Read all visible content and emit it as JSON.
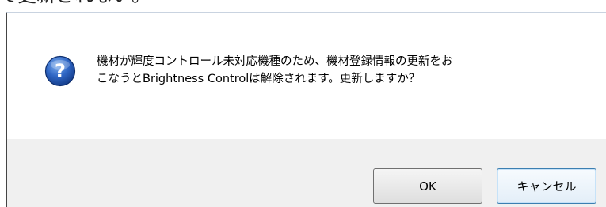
{
  "background_text": "て更新されない。",
  "dialog": {
    "icon": "question-icon",
    "message_line1": "機材が輝度コントロール未対応機種のため、機材登録情報の更新をお",
    "message_line2": "こなうとBrightness Controlは解除されます。更新しますか？",
    "ok_label": "OK",
    "cancel_label": "キャンセル"
  },
  "colors": {
    "icon_blue": "#2a5fb8",
    "footer_bg": "#f0f0f0",
    "default_button_border": "#3c7fb1"
  }
}
